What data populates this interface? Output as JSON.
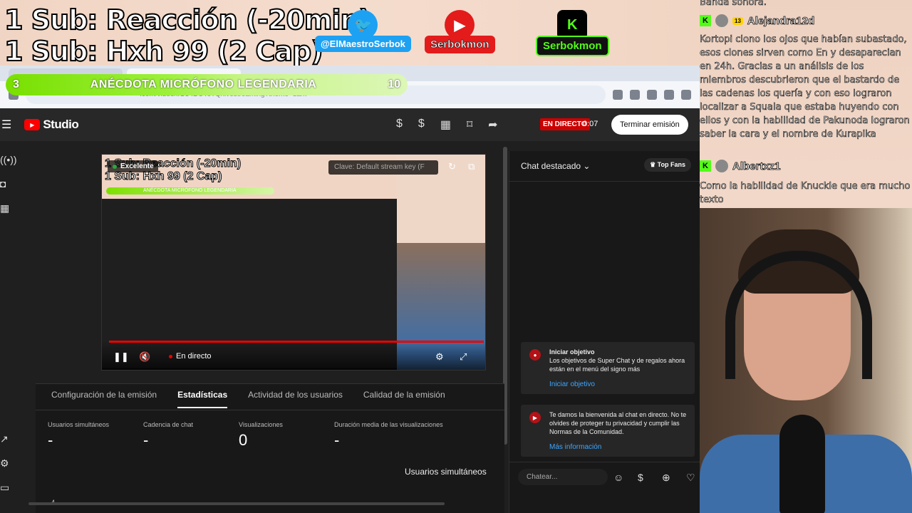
{
  "overlay": {
    "title_line1": "1 Sub: Reacción (-20min)",
    "title_line2": "1 Sub: Hxh 99 (2 Cap)",
    "socials": [
      {
        "name": "twitter",
        "label": "@ElMaestroSerbok",
        "icon": "twitter-bird-icon",
        "color": "#1da1f2"
      },
      {
        "name": "youtube",
        "label": "Serbokmon",
        "icon": "youtube-play-icon",
        "color": "#e31b1b"
      },
      {
        "name": "kick",
        "label": "Serbokmon",
        "icon": "kick-k-icon",
        "color": "#53fc18"
      }
    ],
    "progress": {
      "left_value": "3",
      "label": "ANÉCDOTA MICRÓFONO LEGENDARIA",
      "right_value": "10",
      "fraction": 0.3
    }
  },
  "browser": {
    "url_fragment": ".com/video/lfO54DUToTQ/livestreaming?theme=dark"
  },
  "studio": {
    "logo_text": "Studio",
    "live_badge": "EN DIRECTO",
    "live_time": "0:07",
    "end_button": "Terminar emisión",
    "player": {
      "quality": "Excelente",
      "stream_key": "Clave: Default stream key (F",
      "live_label": "En directo"
    },
    "tabs": [
      "Configuración de la emisión",
      "Estadísticas",
      "Actividad de los usuarios",
      "Calidad de la emisión"
    ],
    "active_tab": "Estadísticas",
    "metrics": [
      {
        "label": "Usuarios simultáneos",
        "value": "-"
      },
      {
        "label": "Cadencia de chat",
        "value": "-"
      },
      {
        "label": "Visualizaciones",
        "value": "0"
      },
      {
        "label": "Duración media de las visualizaciones",
        "value": "-"
      }
    ],
    "concurrent_label": "Usuarios simultáneos",
    "axis_value": "4"
  },
  "chat": {
    "header": "Chat destacado",
    "top_fans": "Top Fans",
    "cards": [
      {
        "title": "Iniciar objetivo",
        "body": "Los objetivos de Super Chat y de regalos ahora están en el menú del signo más",
        "link": "Iniciar objetivo"
      },
      {
        "title": "",
        "body": "Te damos la bienvenida al chat en directo. No te olvides de proteger tu privacidad y cumplir las Normas de la Comunidad.",
        "link": "Más información"
      }
    ],
    "input_placeholder": "Chatear..."
  },
  "overlay_chat": {
    "top_text": "Banda sonora.",
    "user1": "Alejandra12d",
    "user1_badge": "13",
    "message1": "Kortopi clono los ojos que habían subastado, esos clones sirven como En y desaparecian en 24h. Gracias a un análisis de los miembros descubrieron que el bastardo de las cadenas los quería y con eso lograron localizar a Squala que estaba huyendo con ellos y con la habilidad de Pakunoda lograron saber la cara y el nombre de Kurapika",
    "user2": "Albertxz1",
    "message2": "Como la habilidad de Knuckle que era mucho texto"
  }
}
